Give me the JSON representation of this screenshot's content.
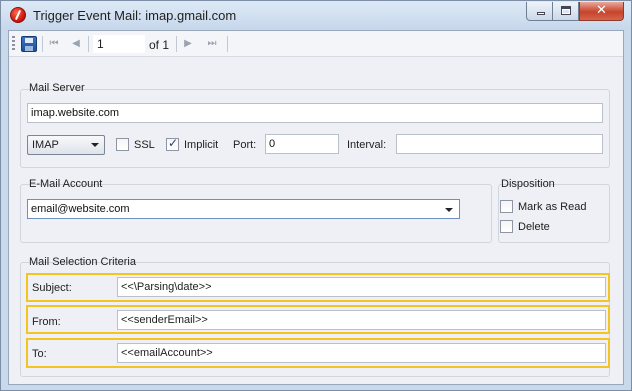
{
  "window": {
    "title": "Trigger Event Mail: imap.gmail.com",
    "close_glyph": "✕"
  },
  "toolbar": {
    "page_value": "1",
    "page_of": "of 1",
    "icons": [
      "save-icon",
      "first-page-icon",
      "previous-page-icon",
      "next-page-icon",
      "last-page-icon"
    ]
  },
  "mail_server": {
    "title": "Mail Server",
    "host": "imap.website.com",
    "protocol": "IMAP",
    "ssl_label": "SSL",
    "ssl_checked": false,
    "implicit_label": "Implicit",
    "implicit_checked": true,
    "port_label": "Port:",
    "port_value": "0",
    "interval_label": "Interval:",
    "interval_value": ""
  },
  "email_account": {
    "title": "E-Mail Account",
    "value": "email@website.com"
  },
  "disposition": {
    "title": "Disposition",
    "mark_as_read_label": "Mark as Read",
    "mark_as_read_checked": false,
    "delete_label": "Delete",
    "delete_checked": false
  },
  "criteria": {
    "title": "Mail Selection Criteria",
    "subject_label": "Subject:",
    "subject_value": "<<\\Parsing\\date>>",
    "from_label": "From:",
    "from_value": "<<senderEmail>>",
    "to_label": "To:",
    "to_value": "<<emailAccount>>"
  },
  "colors": {
    "highlight": "#f4c522",
    "window_frame": "#c9d9ec",
    "panel_bg": "#eef0f5"
  }
}
